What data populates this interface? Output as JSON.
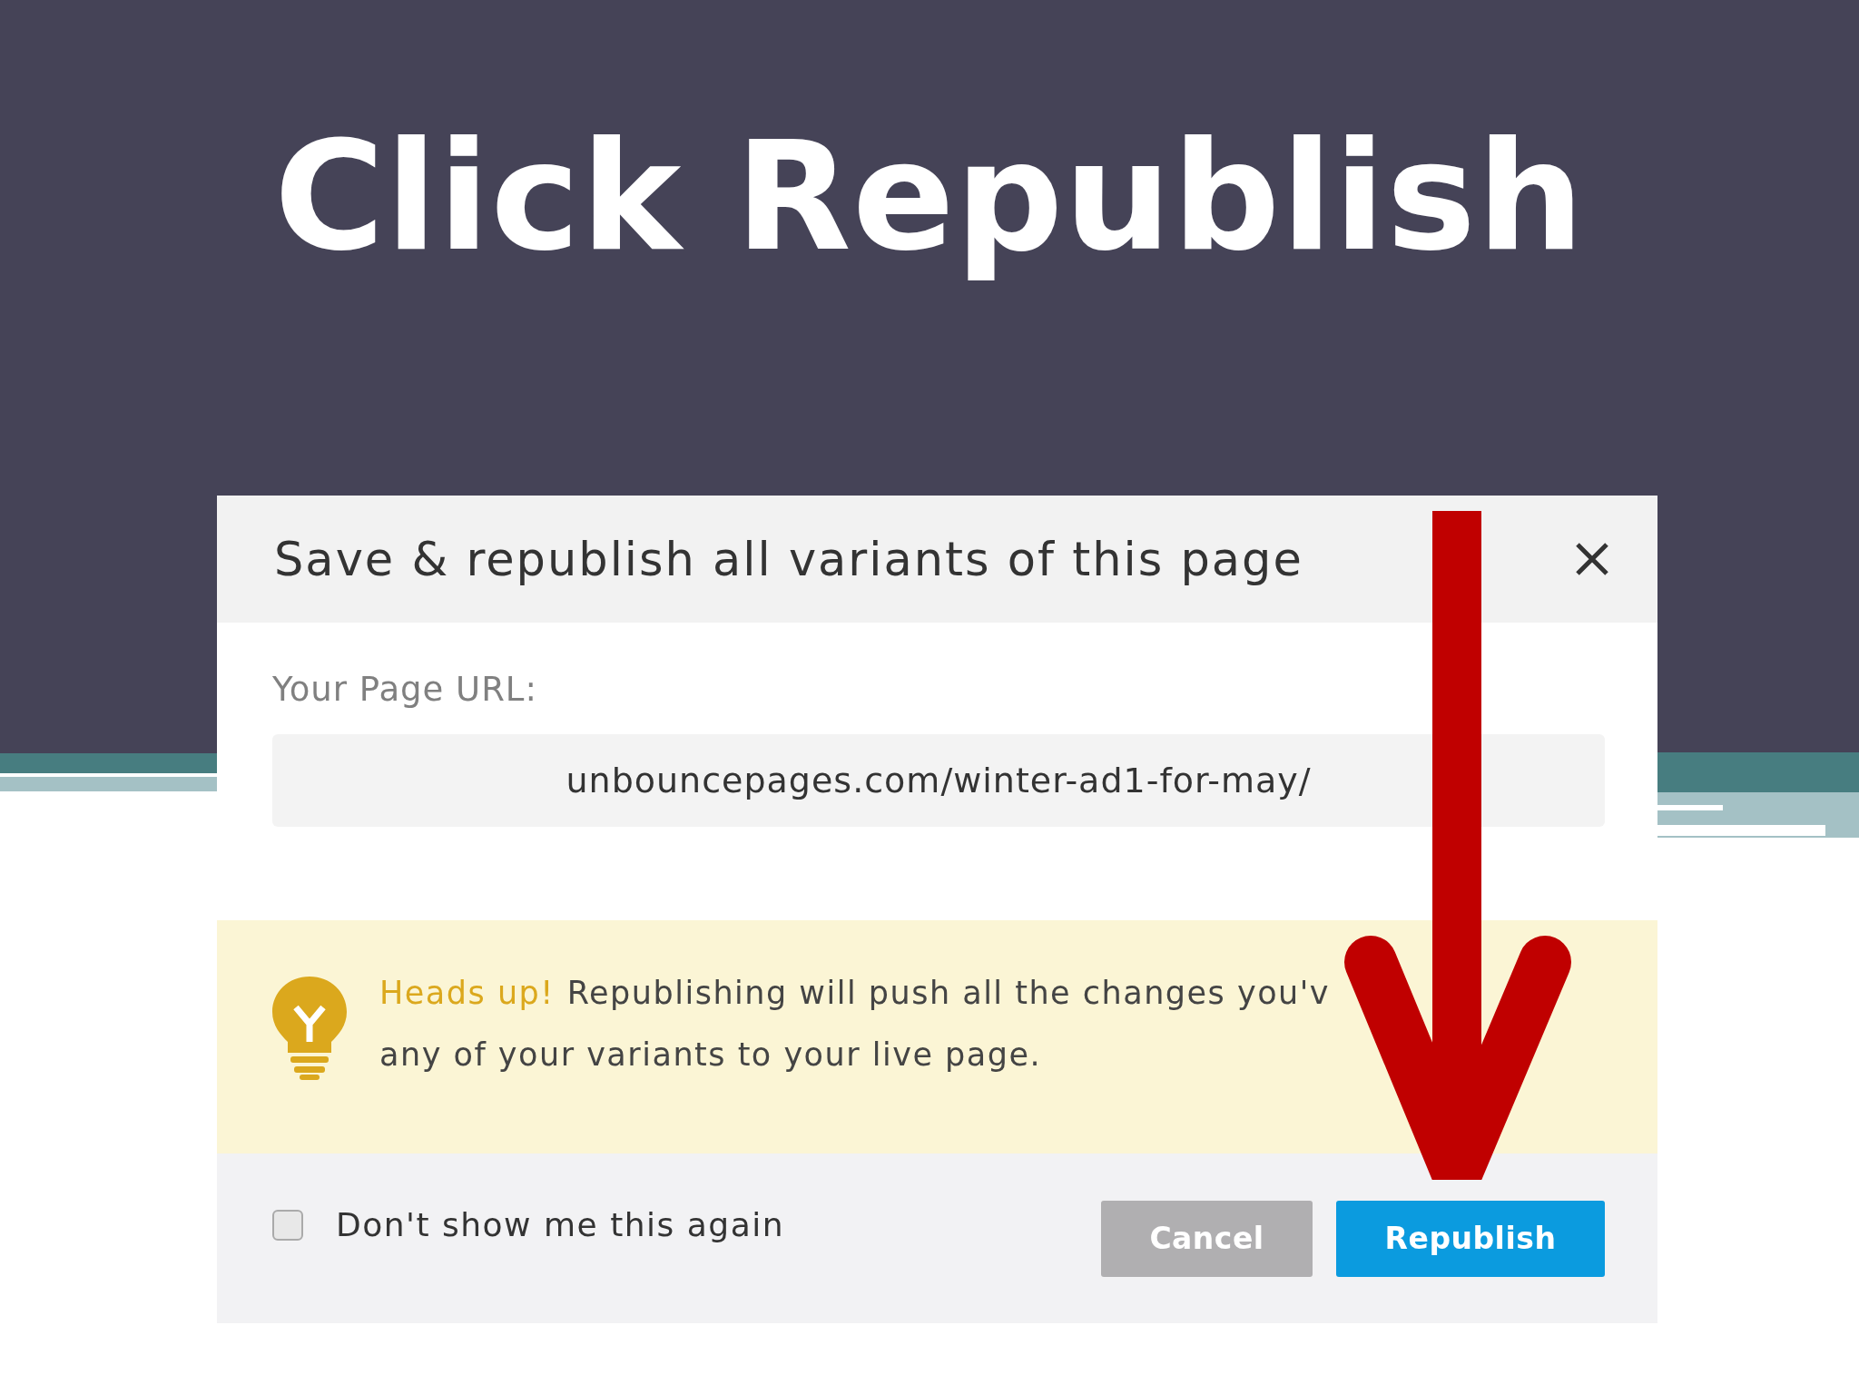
{
  "slide": {
    "title": "Click Republish"
  },
  "dialog": {
    "title": "Save & republish all variants of this page",
    "url_label": "Your Page URL:",
    "url": "unbouncepages.com/winter-ad1-for-may/",
    "notice": {
      "heading": "Heads up!",
      "lines": [
        "Republishing will push all the changes you'v",
        "any of your variants to your live page."
      ]
    },
    "dont_show": {
      "label": "Don't show me this again",
      "checked": false
    },
    "buttons": [
      {
        "label": "Cancel",
        "kind": "secondary"
      },
      {
        "label": "Republish",
        "kind": "primary"
      }
    ]
  }
}
